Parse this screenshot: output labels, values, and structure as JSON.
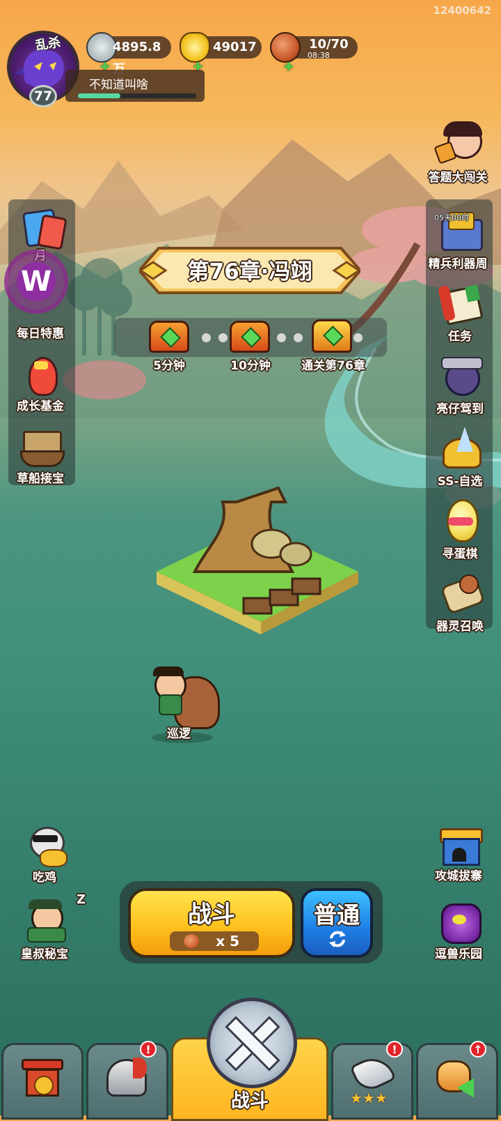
{
  "user_id": "12400642",
  "profile": {
    "avatar_tag": "乱杀",
    "level": "77",
    "name": "不知道叫啥",
    "exp_fraction": 0.36
  },
  "resources": {
    "silver": "4895.8万",
    "gold": "49017",
    "stamina": "10/70",
    "stamina_timer": "08:38"
  },
  "left_menu": [
    {
      "label": "每日特惠",
      "icon": "daily-deal-icon"
    },
    {
      "label": "成长基金",
      "icon": "growth-fund-icon"
    },
    {
      "label": "草船接宝",
      "icon": "straw-boat-treasure-icon"
    }
  ],
  "left_top_partial_label": "月",
  "right_menu_top": {
    "label": "答题大闯关",
    "icon": "quiz-challenge-icon"
  },
  "right_menu": [
    {
      "label": "精兵利器周",
      "icon": "elite-weapon-week-icon",
      "timer": "05天00时"
    },
    {
      "label": "任务",
      "icon": "task-scroll-icon"
    },
    {
      "label": "亮仔驾到",
      "icon": "liangzai-arrival-icon"
    },
    {
      "label": "SS-自选",
      "icon": "ss-select-icon"
    },
    {
      "label": "寻蛋棋",
      "icon": "egg-hunt-icon"
    },
    {
      "label": "器灵召唤",
      "icon": "spirit-summon-icon"
    }
  ],
  "chapter": {
    "title": "第76章·冯翊",
    "rewards": [
      {
        "label": "5分钟"
      },
      {
        "label": "10分钟"
      },
      {
        "label": "通关第76章"
      }
    ]
  },
  "patrol_label": "巡逻",
  "left_bottom": [
    {
      "label": "吃鸡",
      "icon": "chicken-dinner-icon"
    },
    {
      "label": "皇叔秘宝",
      "icon": "uncle-treasure-icon",
      "sleep": "z"
    }
  ],
  "right_bottom": [
    {
      "label": "攻城拔寨",
      "icon": "siege-fortress-icon"
    },
    {
      "label": "逗兽乐园",
      "icon": "beast-park-icon"
    }
  ],
  "battle": {
    "fight_label": "战斗",
    "cost": "x 5",
    "mode_label": "普通"
  },
  "nav": {
    "center_label": "战斗",
    "tabs": [
      "city-hall-icon",
      "helmet-icon",
      "battle-swords-icon",
      "horn-stars-icon",
      "fist-upgrade-icon"
    ]
  },
  "colors": {
    "accent_gold": "#ffc21f",
    "mode_blue": "#1e7de4",
    "badge_red": "#e2242a",
    "exp_green": "#58d8a4"
  }
}
